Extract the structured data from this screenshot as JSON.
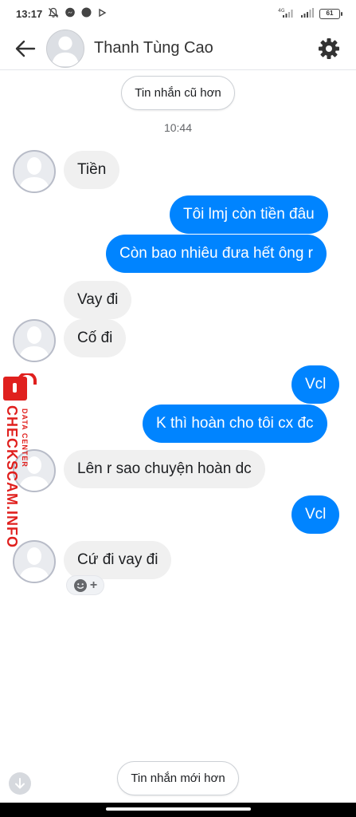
{
  "status_bar": {
    "time": "13:17",
    "network": "4G",
    "battery": "61"
  },
  "header": {
    "contact_name": "Thanh Tùng Cao"
  },
  "older_messages_label": "Tin nhắn cũ hơn",
  "newer_messages_label": "Tin nhắn mới hơn",
  "timestamp": "10:44",
  "messages": [
    {
      "from": "them",
      "text": "Tiền"
    },
    {
      "from": "me",
      "text": "Tôi lmj còn tiền đâu"
    },
    {
      "from": "me",
      "text": "Còn bao nhiêu đưa hết ông r"
    },
    {
      "from": "them",
      "text": "Vay đi"
    },
    {
      "from": "them",
      "text": "Cố đi"
    },
    {
      "from": "me",
      "text": "Vcl"
    },
    {
      "from": "me",
      "text": "K thì hoàn cho tôi cx đc"
    },
    {
      "from": "them",
      "text": "Lên r sao chuyện hoàn dc"
    },
    {
      "from": "me",
      "text": "Vcl"
    },
    {
      "from": "them",
      "text": "Cứ đi vay đi"
    }
  ],
  "watermark": {
    "main": "CHECKSCAM.INFO",
    "sub": "DATA CENTER"
  },
  "colors": {
    "outgoing_bubble": "#0084ff",
    "incoming_bubble": "#f0f0f0",
    "watermark": "#e0201e"
  },
  "icons": {
    "back": "arrow-left-icon",
    "settings": "gear-icon",
    "reaction": "smiley-icon",
    "scroll": "arrow-down-icon"
  }
}
